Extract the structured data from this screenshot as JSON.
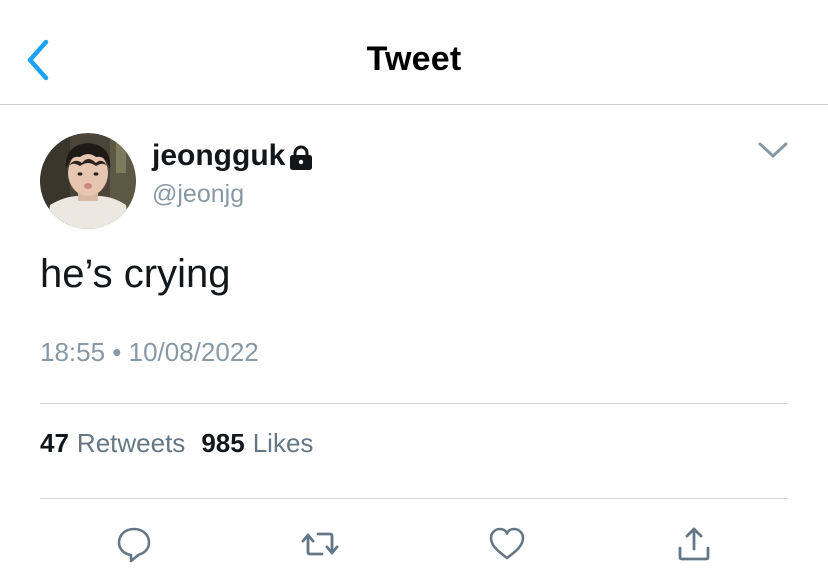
{
  "header": {
    "title": "Tweet",
    "back_icon": "chevron-left-icon"
  },
  "colors": {
    "accent": "#1da1f2",
    "secondary_text": "#8899a6",
    "icon_gray": "#657786"
  },
  "tweet": {
    "author": {
      "name": "jeongguk",
      "handle": "@jeonjg",
      "protected_icon": "lock-icon"
    },
    "text": "he’s crying",
    "meta": "18:55 • 10/08/2022",
    "stats": {
      "retweets_count": "47",
      "retweets_label": "Retweets",
      "likes_count": "985",
      "likes_label": "Likes"
    },
    "actions": [
      {
        "name": "reply",
        "icon": "reply-icon"
      },
      {
        "name": "retweet",
        "icon": "retweet-icon"
      },
      {
        "name": "like",
        "icon": "heart-icon"
      },
      {
        "name": "share",
        "icon": "share-icon"
      }
    ]
  }
}
